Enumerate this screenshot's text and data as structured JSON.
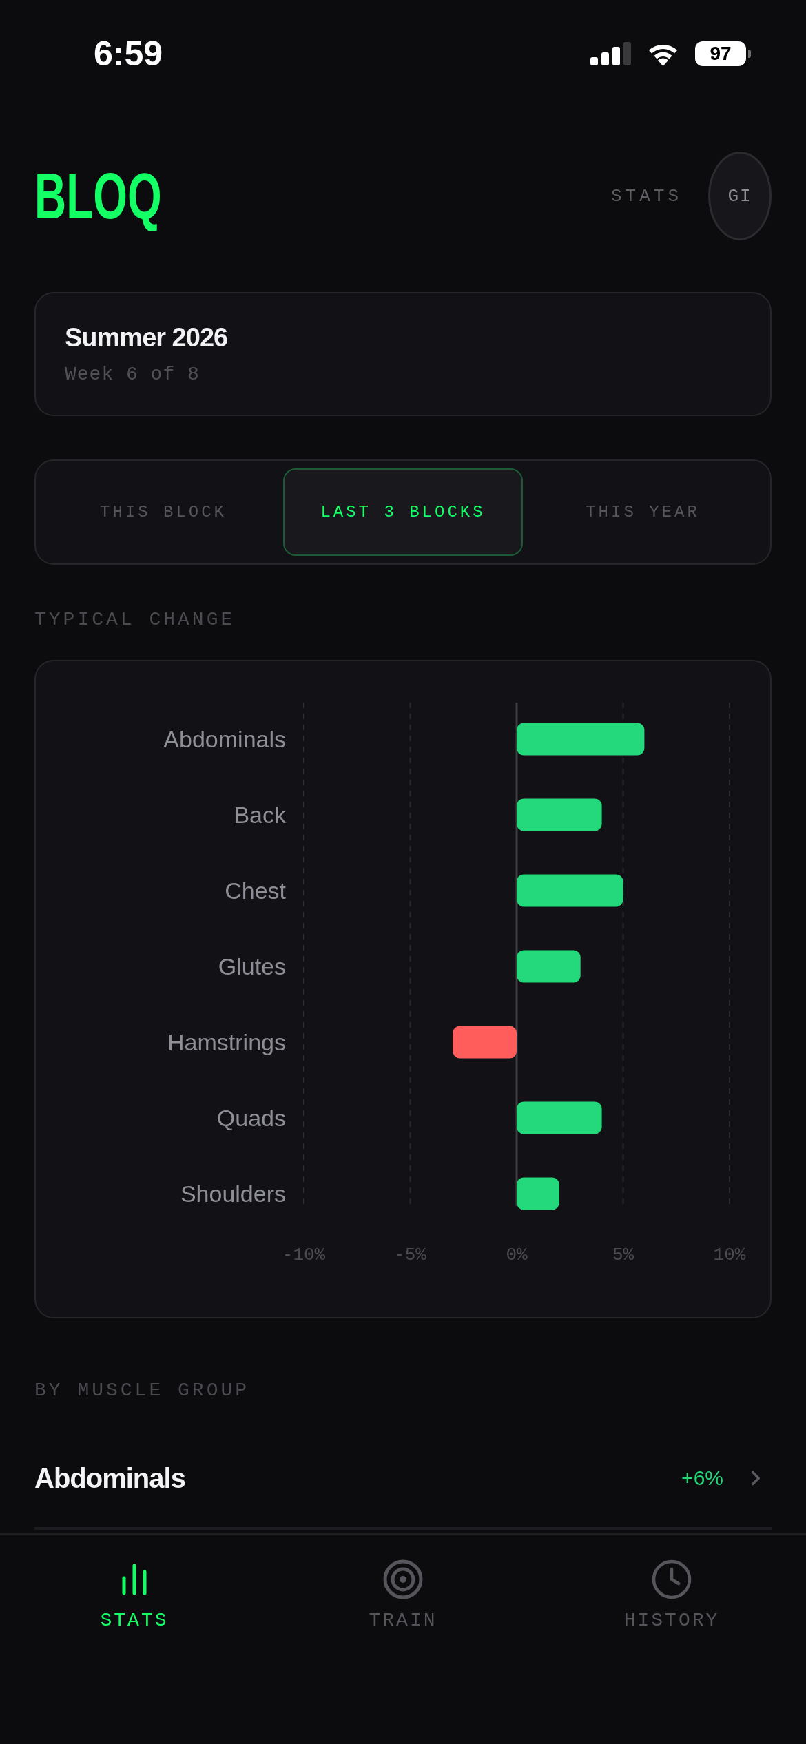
{
  "status_bar": {
    "time": "6:59",
    "battery": "97"
  },
  "header": {
    "brand": "BLOQ",
    "section": "STATS",
    "avatar": "GI"
  },
  "block": {
    "title": "Summer 2026",
    "subtitle": "Week 6 of 8"
  },
  "range_tabs": [
    {
      "label": "THIS BLOCK",
      "selected": false
    },
    {
      "label": "LAST 3 BLOCKS",
      "selected": true
    },
    {
      "label": "THIS YEAR",
      "selected": false
    }
  ],
  "typical_change": {
    "heading": "TYPICAL CHANGE",
    "chart_data": {
      "type": "bar",
      "orientation": "horizontal",
      "categories": [
        "Abdominals",
        "Back",
        "Chest",
        "Glutes",
        "Hamstrings",
        "Quads",
        "Shoulders"
      ],
      "series": [
        {
          "color": "#23d97c",
          "values": [
            6,
            4,
            5,
            3,
            null,
            4,
            2
          ]
        },
        {
          "color": "#ff5c5c",
          "values": [
            null,
            null,
            null,
            null,
            -3,
            null,
            null
          ]
        }
      ],
      "xlim": [
        -10,
        10
      ],
      "xticks": [
        {
          "value": -10,
          "label": "-10%"
        },
        {
          "value": -5,
          "label": "-5%"
        },
        {
          "value": 0,
          "label": "0%"
        },
        {
          "value": 5,
          "label": "5%"
        },
        {
          "value": 10,
          "label": "10%"
        }
      ]
    }
  },
  "muscle_groups": {
    "heading": "BY MUSCLE GROUP",
    "rows": [
      {
        "name": "Abdominals",
        "change": "+6%",
        "color": "#23d97c"
      }
    ]
  },
  "tab_bar": [
    {
      "label": "STATS",
      "kind": "stats",
      "selected": true
    },
    {
      "label": "TRAIN",
      "kind": "train",
      "selected": false
    },
    {
      "label": "HISTORY",
      "kind": "history",
      "selected": false
    }
  ]
}
